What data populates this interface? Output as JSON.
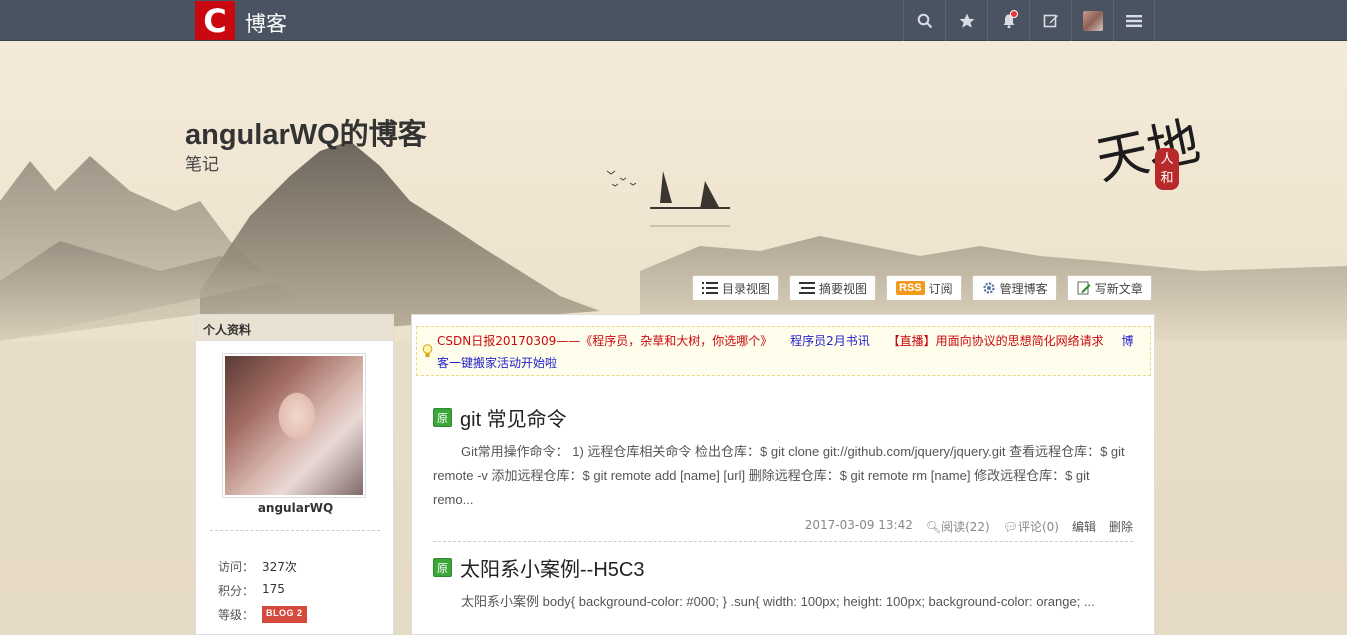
{
  "topbar": {
    "logo_letter": "C",
    "brand": "博客",
    "icons": [
      "search-icon",
      "star-icon",
      "bell-icon",
      "edit-icon",
      "avatar",
      "menu-icon"
    ]
  },
  "header": {
    "title": "angularWQ的博客",
    "subtitle": "笔记",
    "calligraphy": "天地",
    "seal": "人和"
  },
  "toolbar": {
    "dir_view": "目录视图",
    "summary_view": "摘要视图",
    "rss_tag": "RSS",
    "subscribe": "订阅",
    "manage": "管理博客",
    "write": "写新文章"
  },
  "sidebar": {
    "heading": "个人资料",
    "username": "angularWQ",
    "stats": [
      {
        "label": "访问：",
        "value": "327次"
      },
      {
        "label": "积分：",
        "value": "175"
      },
      {
        "label": "等级：",
        "value": "BLOG 2"
      }
    ]
  },
  "notice": {
    "items": [
      {
        "text": "CSDN日报20170309——《程序员，杂草和大树，你选哪个》",
        "color": "red"
      },
      {
        "text": "程序员2月书讯",
        "color": "blue"
      },
      {
        "text": "【直播】用面向协议的思想简化网络请求",
        "color": "red"
      },
      {
        "text": "博客一键搬家活动开始啦",
        "color": "blue"
      }
    ]
  },
  "articles": [
    {
      "badge": "原",
      "title": "git 常见命令",
      "body": "Git常用操作命令： 1) 远程仓库相关命令 检出仓库：$ git clone git://github.com/jquery/jquery.git 查看远程仓库：$ git remote -v 添加远程仓库：$ git remote add [name] [url] 删除远程仓库：$ git remote rm [name] 修改远程仓库：$ git remo...",
      "date": "2017-03-09 13:42",
      "reads": "阅读(22)",
      "comments": "评论(0)",
      "edit": "编辑",
      "delete": "删除"
    },
    {
      "badge": "原",
      "title": "太阳系小案例--H5C3",
      "body": "太阳系小案例 body{ background-color: #000; } .sun{ width: 100px; height: 100px; background-color: orange; ..."
    }
  ]
}
